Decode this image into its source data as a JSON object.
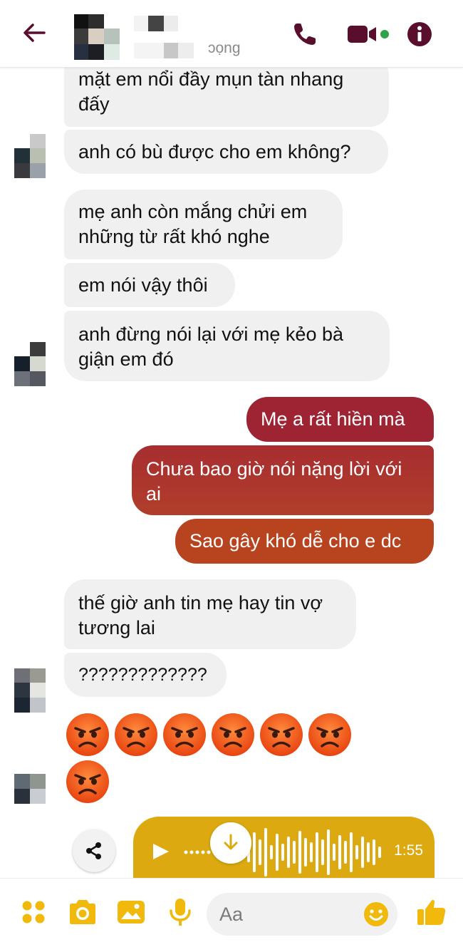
{
  "header": {
    "status_text": "ɔọng",
    "colors": {
      "accent": "#5a0e2d",
      "online": "#31a24c"
    }
  },
  "messages": [
    {
      "side": "in",
      "text": "mặt em nổi đầy mụn tàn nhang đấy"
    },
    {
      "side": "in",
      "text": "anh có bù được cho em không?"
    },
    {
      "side": "in",
      "text": "mẹ anh còn mắng chửi em những từ rất khó nghe"
    },
    {
      "side": "in",
      "text": "em nói vậy thôi"
    },
    {
      "side": "in",
      "text": "anh đừng nói lại với mẹ kẻo bà giận em đó"
    },
    {
      "side": "out",
      "text": "Mẹ a rất hiền mà"
    },
    {
      "side": "out",
      "text": "Chưa bao giờ nói nặng lời với ai"
    },
    {
      "side": "out",
      "text": "Sao gây khó dễ cho e dc"
    },
    {
      "side": "in",
      "text": "thế giờ anh tin mẹ hay tin vợ tương lai"
    },
    {
      "side": "in",
      "text": "?????????????"
    }
  ],
  "emoji_reaction": {
    "icon": "angry-face-emoji",
    "count": 7
  },
  "voice_message": {
    "duration": "1:55",
    "color": "#dcaa10"
  },
  "composer": {
    "placeholder": "Aa",
    "accent_color": "#f0b90b"
  }
}
